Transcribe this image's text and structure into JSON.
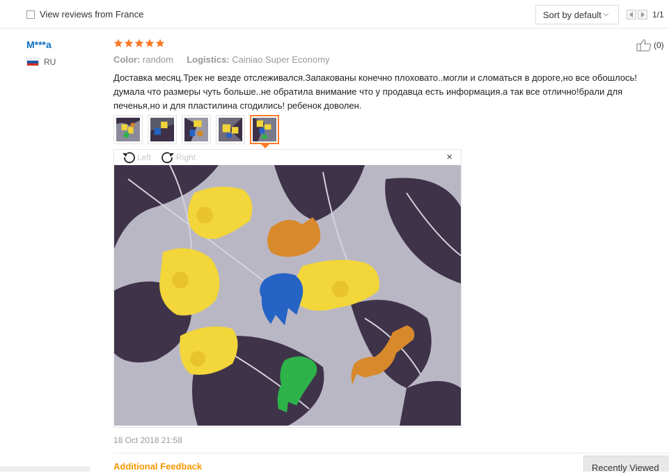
{
  "toolbar": {
    "filter_label": "View reviews from France",
    "sort_label": "Sort by default",
    "page_indicator": "1/1"
  },
  "review": {
    "user": "M***a",
    "country": "RU",
    "rating": 5,
    "color_label": "Color:",
    "color_value": "random",
    "logistics_label": "Logistics:",
    "logistics_value": "Cainiao Super Economy",
    "helpful_count": "(0)",
    "text": "Доставка месяц.Трек не везде отслеживался.Запакованы конечно плоховато..могли и сломаться в дороге,но все обошлось! думала что размеры чуть больше..не обратила внимание что у продавца есть информация.а так все отлично!брали для печенья,но и для пластилина сгодились! ребенок доволен.",
    "thumbnails": 5,
    "active_thumbnail": 5,
    "date": "18 Oct 2018 21:58"
  },
  "viewer": {
    "rotate_left": "Left",
    "rotate_right": "Right",
    "close_label": "×"
  },
  "footer": {
    "additional_feedback": "Additional Feedback",
    "recently_viewed": "Recently Viewed"
  },
  "colors": {
    "username": "#0a6dc2",
    "star": "#ff7a2a",
    "accent_orange": "#f39800",
    "active_thumb_border": "#ff7a2a"
  },
  "icons": [
    "checkbox-icon",
    "chevron-down-icon",
    "prev-page-icon",
    "next-page-icon",
    "star-icon",
    "thumbs-up-icon",
    "russia-flag-icon",
    "rotate-left-icon",
    "rotate-right-icon",
    "close-icon"
  ]
}
